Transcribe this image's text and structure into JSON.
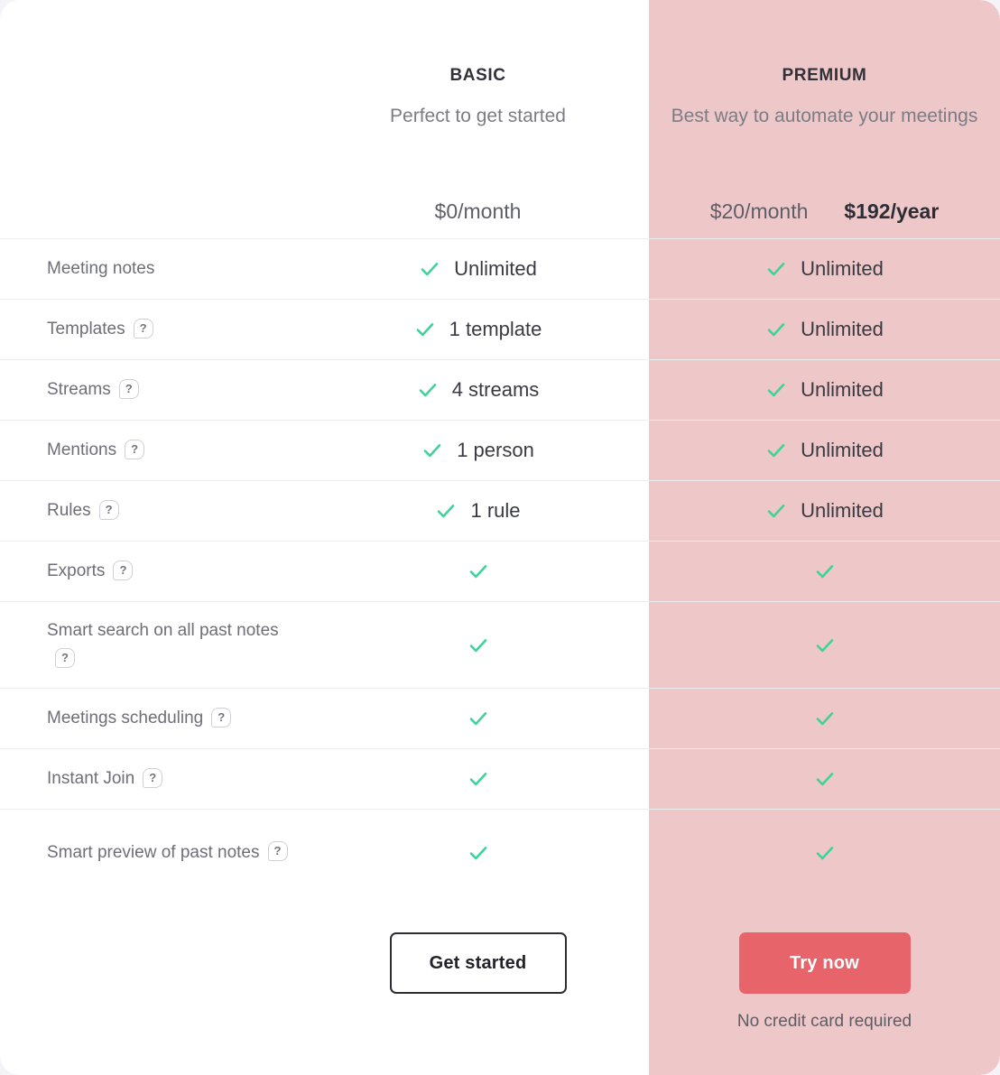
{
  "theme": {
    "card_background": "#ffffff",
    "page_background": "#f4f4f8",
    "premium_panel_background": "#eec7c8",
    "check_color": "#3fd29a",
    "primary_button_color": "#e8646b",
    "divider_color": "#ededf0",
    "muted_text_color": "#7c7c85"
  },
  "plans": {
    "basic": {
      "name": "BASIC",
      "tagline": "Perfect to get started",
      "price_monthly": "$0/month",
      "cta_label": "Get started"
    },
    "premium": {
      "name": "PREMIUM",
      "tagline": "Best way to automate your meetings",
      "price_monthly": "$20/month",
      "price_yearly": "$192/year",
      "cta_label": "Try now",
      "cta_note": "No credit card required"
    }
  },
  "features": [
    {
      "label": "Meeting notes",
      "has_help": false,
      "basic": {
        "check": true,
        "value": "Unlimited"
      },
      "premium": {
        "check": true,
        "value": "Unlimited"
      }
    },
    {
      "label": "Templates",
      "has_help": true,
      "basic": {
        "check": true,
        "value": "1 template"
      },
      "premium": {
        "check": true,
        "value": "Unlimited"
      }
    },
    {
      "label": "Streams",
      "has_help": true,
      "basic": {
        "check": true,
        "value": "4 streams"
      },
      "premium": {
        "check": true,
        "value": "Unlimited"
      }
    },
    {
      "label": "Mentions",
      "has_help": true,
      "basic": {
        "check": true,
        "value": "1 person"
      },
      "premium": {
        "check": true,
        "value": "Unlimited"
      }
    },
    {
      "label": "Rules",
      "has_help": true,
      "basic": {
        "check": true,
        "value": "1 rule"
      },
      "premium": {
        "check": true,
        "value": "Unlimited"
      }
    },
    {
      "label": "Exports",
      "has_help": true,
      "basic": {
        "check": true,
        "value": ""
      },
      "premium": {
        "check": true,
        "value": ""
      }
    },
    {
      "label": "Smart search on all past notes",
      "has_help": true,
      "basic": {
        "check": true,
        "value": ""
      },
      "premium": {
        "check": true,
        "value": ""
      }
    },
    {
      "label": "Meetings scheduling",
      "has_help": true,
      "basic": {
        "check": true,
        "value": ""
      },
      "premium": {
        "check": true,
        "value": ""
      }
    },
    {
      "label": "Instant Join",
      "has_help": true,
      "basic": {
        "check": true,
        "value": ""
      },
      "premium": {
        "check": true,
        "value": ""
      }
    },
    {
      "label": "Smart preview of past notes",
      "has_help": true,
      "basic": {
        "check": true,
        "value": ""
      },
      "premium": {
        "check": true,
        "value": ""
      }
    }
  ],
  "icons": {
    "help": "?",
    "check": "check-icon"
  }
}
